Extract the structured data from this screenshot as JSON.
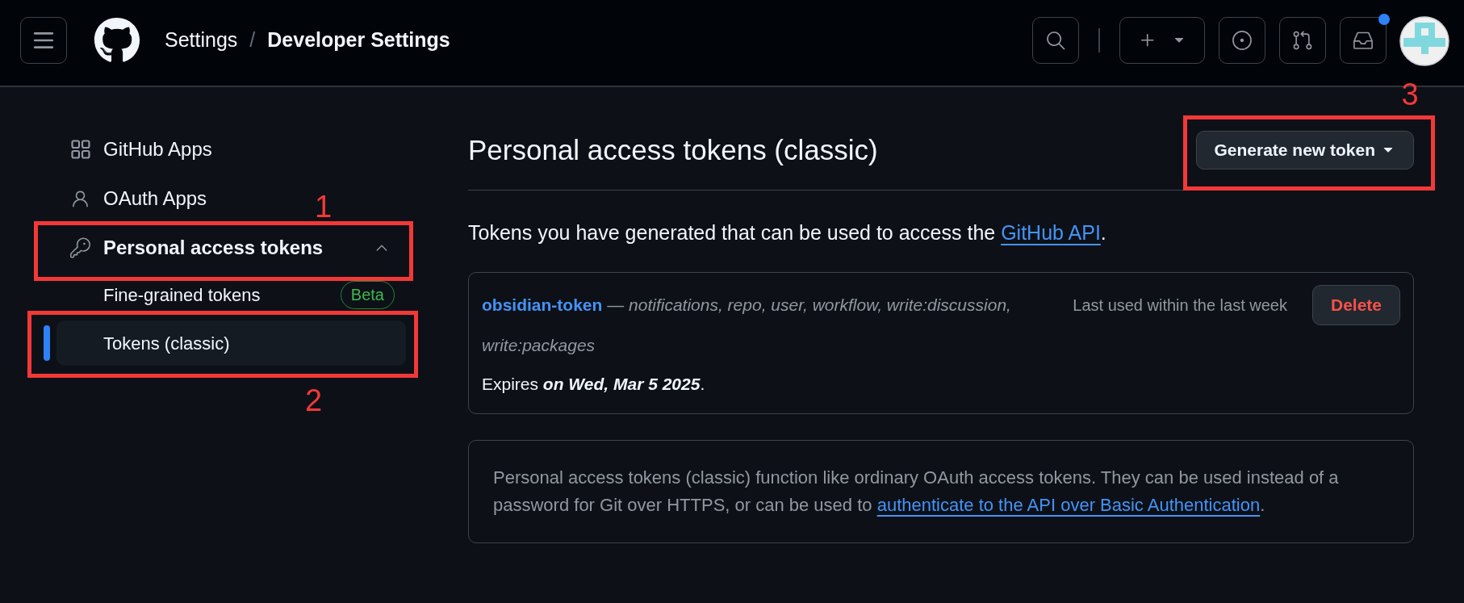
{
  "header": {
    "breadcrumb": [
      {
        "label": "Settings",
        "current": false
      },
      {
        "label": "Developer Settings",
        "current": true
      }
    ],
    "separator": "/",
    "inbox_unread": true
  },
  "sidebar": {
    "items": [
      {
        "label": "GitHub Apps",
        "selected": false
      },
      {
        "label": "OAuth Apps",
        "selected": false
      },
      {
        "label": "Personal access tokens",
        "selected": false,
        "expanded": true,
        "annotation": "1",
        "children": [
          {
            "label": "Fine-grained tokens",
            "selected": false,
            "badge": "Beta"
          },
          {
            "label": "Tokens (classic)",
            "selected": true,
            "annotation": "2"
          }
        ]
      }
    ]
  },
  "main": {
    "title": "Personal access tokens (classic)",
    "generate_button": {
      "label": "Generate new token",
      "annotation": "3"
    },
    "description": {
      "text": "Tokens you have generated that can be used to access the ",
      "link": "GitHub API",
      "end": "."
    },
    "tokens": [
      {
        "name": "obsidian-token",
        "separator": "—",
        "scopes": "notifications, repo, user, workflow, write:discussion, write:packages",
        "last_used": "Last used within the last week",
        "expires": "Expires **on Wed, Mar 5 2025**.",
        "delete_label": "Delete"
      }
    ],
    "note": {
      "text": "Personal access tokens (classic) function like ordinary OAuth access tokens. They can be used instead of a password for Git over HTTPS, or can be used to ",
      "link": "authenticate to the API over Basic Authentication",
      "end": "."
    }
  }
}
